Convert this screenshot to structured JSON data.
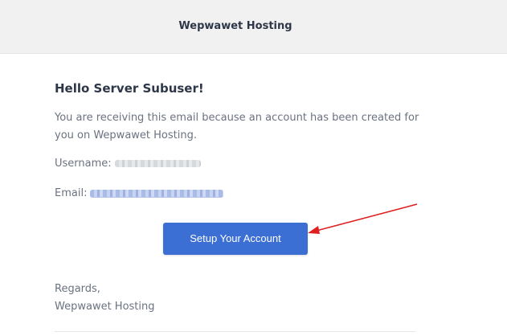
{
  "header": {
    "title": "Wepwawet Hosting"
  },
  "email": {
    "greeting": "Hello Server Subuser!",
    "intro": "You are receiving this email because an account has been created for you on Wepwawet Hosting.",
    "username_label": "Username:",
    "email_label": "Email:",
    "button_label": "Setup Your Account",
    "regards": "Regards,",
    "signature": "Wepwawet Hosting"
  },
  "colors": {
    "button": "#3b6fd4",
    "arrow": "#e02020",
    "header_bg": "#f1f1f2"
  }
}
